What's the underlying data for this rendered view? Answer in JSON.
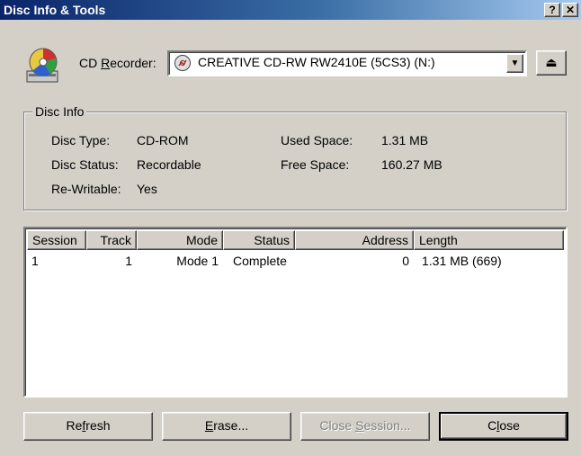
{
  "window": {
    "title": "Disc Info & Tools",
    "help_label": "?",
    "close_label": "✕"
  },
  "recorder": {
    "label_prefix": "CD ",
    "label_mnemonic": "R",
    "label_rest": "ecorder:",
    "selected": "CREATIVE CD-RW RW2410E (5CS3) (N:)",
    "eject_label": "⏏"
  },
  "disc_info": {
    "title": "Disc Info",
    "disc_type_label": "Disc Type:",
    "disc_type": "CD-ROM",
    "disc_status_label": "Disc Status:",
    "disc_status": "Recordable",
    "rewritable_label": "Re-Writable:",
    "rewritable": "Yes",
    "used_space_label": "Used Space:",
    "used_space": "1.31 MB",
    "free_space_label": "Free Space:",
    "free_space": "160.27 MB"
  },
  "table": {
    "headers": [
      "Session",
      "Track",
      "Mode",
      "Status",
      "Address",
      "Length"
    ],
    "rows": [
      [
        "1",
        "1",
        "Mode 1",
        "Complete",
        "0",
        "1.31 MB (669)"
      ]
    ]
  },
  "buttons": {
    "refresh_pre": "Re",
    "refresh_mn": "f",
    "refresh_post": "resh",
    "erase_mn": "E",
    "erase_post": "rase...",
    "close_session_pre": "Close ",
    "close_session_mn": "S",
    "close_session_post": "ession...",
    "close_pre": "C",
    "close_mn": "l",
    "close_post": "ose"
  }
}
